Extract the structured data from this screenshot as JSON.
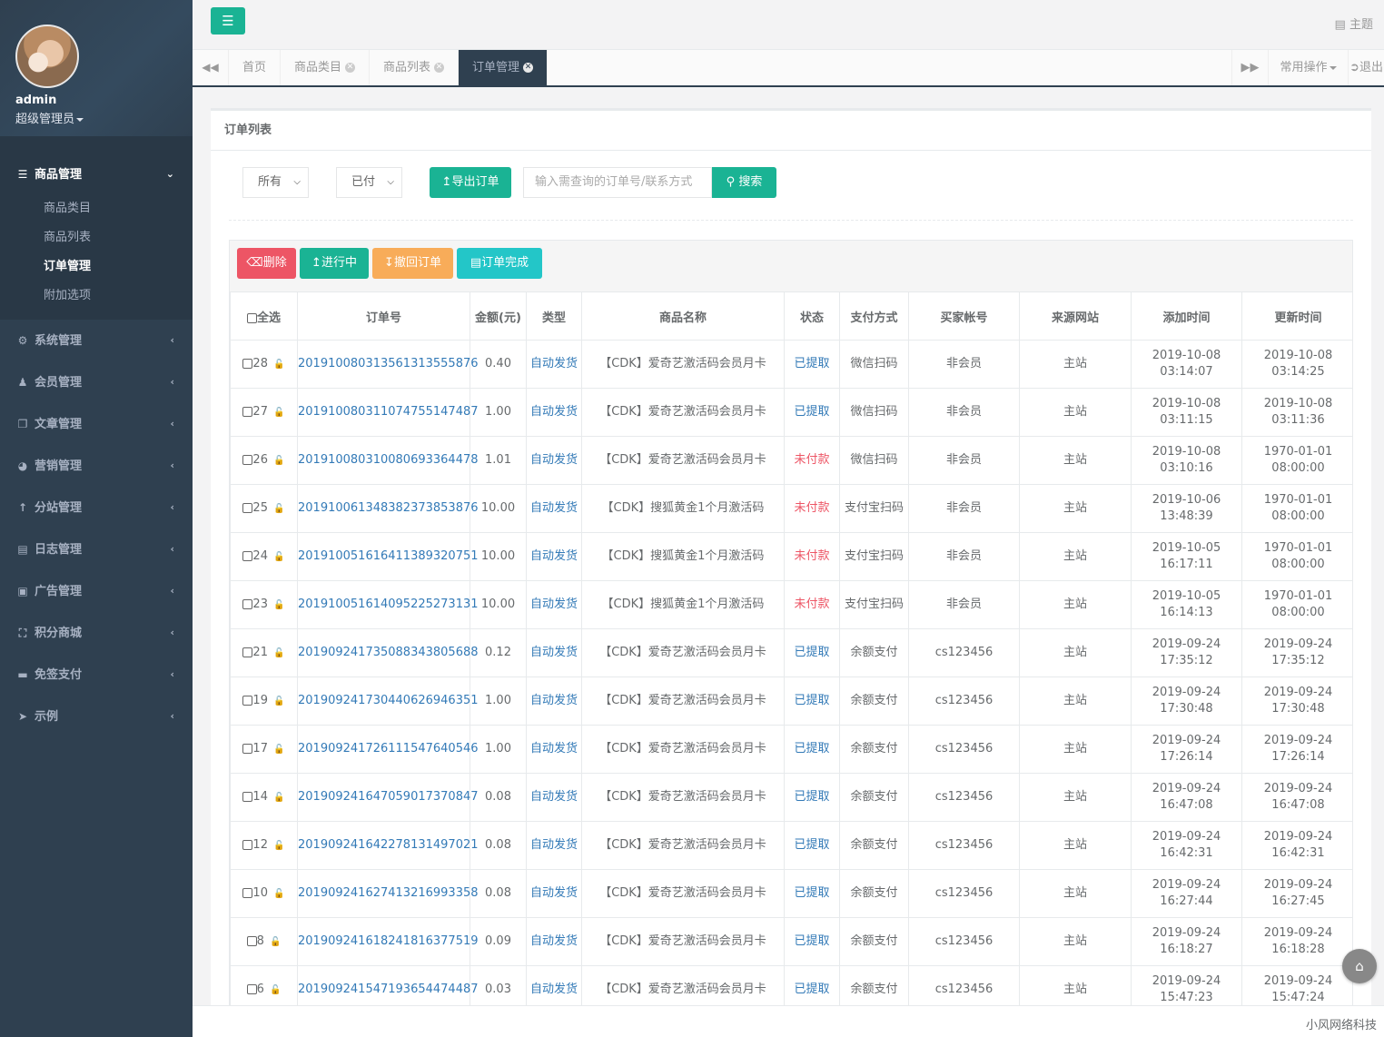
{
  "profile": {
    "name": "admin",
    "role": "超级管理员"
  },
  "nav": {
    "open_group": "商品管理",
    "sub_items": [
      "商品类目",
      "商品列表",
      "订单管理",
      "附加选项"
    ],
    "groups": [
      "系统管理",
      "会员管理",
      "文章管理",
      "营销管理",
      "分站管理",
      "日志管理",
      "广告管理",
      "积分商城",
      "免签支付",
      "示例"
    ]
  },
  "topbar": {
    "theme_label": "主题"
  },
  "tabs": {
    "items": [
      "首页",
      "商品类目",
      "商品列表",
      "订单管理"
    ],
    "common_ops": "常用操作",
    "logout": "退出"
  },
  "panel": {
    "title": "订单列表",
    "filter_all": "所有",
    "filter_status": "已付",
    "export_label": "导出订单",
    "search_placeholder": "输入需查询的订单号/联系方式",
    "search_label": "搜索"
  },
  "toolbar": {
    "delete": "删除",
    "in_progress": "进行中",
    "revoke": "撤回订单",
    "complete": "订单完成"
  },
  "table": {
    "headers": [
      "全选",
      "订单号",
      "金额(元)",
      "类型",
      "商品名称",
      "状态",
      "支付方式",
      "买家帐号",
      "来源网站",
      "添加时间",
      "更新时间"
    ],
    "rows": [
      {
        "id": "28",
        "order": "201910080313561313555876",
        "amount": "0.40",
        "type": "自动发货",
        "product": "【CDK】爱奇艺激活码会员月卡",
        "status": "已提取",
        "pay": "微信扫码",
        "buyer": "非会员",
        "site": "主站",
        "added": "2019-10-08 03:14:07",
        "updated": "2019-10-08 03:14:25"
      },
      {
        "id": "27",
        "order": "201910080311074755147487",
        "amount": "1.00",
        "type": "自动发货",
        "product": "【CDK】爱奇艺激活码会员月卡",
        "status": "已提取",
        "pay": "微信扫码",
        "buyer": "非会员",
        "site": "主站",
        "added": "2019-10-08 03:11:15",
        "updated": "2019-10-08 03:11:36"
      },
      {
        "id": "26",
        "order": "201910080310080693364478",
        "amount": "1.01",
        "type": "自动发货",
        "product": "【CDK】爱奇艺激活码会员月卡",
        "status": "未付款",
        "pay": "微信扫码",
        "buyer": "非会员",
        "site": "主站",
        "added": "2019-10-08 03:10:16",
        "updated": "1970-01-01 08:00:00"
      },
      {
        "id": "25",
        "order": "201910061348382373853876",
        "amount": "10.00",
        "type": "自动发货",
        "product": "【CDK】搜狐黄金1个月激活码",
        "status": "未付款",
        "pay": "支付宝扫码",
        "buyer": "非会员",
        "site": "主站",
        "added": "2019-10-06 13:48:39",
        "updated": "1970-01-01 08:00:00"
      },
      {
        "id": "24",
        "order": "201910051616411389320751",
        "amount": "10.00",
        "type": "自动发货",
        "product": "【CDK】搜狐黄金1个月激活码",
        "status": "未付款",
        "pay": "支付宝扫码",
        "buyer": "非会员",
        "site": "主站",
        "added": "2019-10-05 16:17:11",
        "updated": "1970-01-01 08:00:00"
      },
      {
        "id": "23",
        "order": "201910051614095225273131",
        "amount": "10.00",
        "type": "自动发货",
        "product": "【CDK】搜狐黄金1个月激活码",
        "status": "未付款",
        "pay": "支付宝扫码",
        "buyer": "非会员",
        "site": "主站",
        "added": "2019-10-05 16:14:13",
        "updated": "1970-01-01 08:00:00"
      },
      {
        "id": "21",
        "order": "201909241735088343805688",
        "amount": "0.12",
        "type": "自动发货",
        "product": "【CDK】爱奇艺激活码会员月卡",
        "status": "已提取",
        "pay": "余额支付",
        "buyer": "cs123456",
        "site": "主站",
        "added": "2019-09-24 17:35:12",
        "updated": "2019-09-24 17:35:12"
      },
      {
        "id": "19",
        "order": "201909241730440626946351",
        "amount": "1.00",
        "type": "自动发货",
        "product": "【CDK】爱奇艺激活码会员月卡",
        "status": "已提取",
        "pay": "余额支付",
        "buyer": "cs123456",
        "site": "主站",
        "added": "2019-09-24 17:30:48",
        "updated": "2019-09-24 17:30:48"
      },
      {
        "id": "17",
        "order": "201909241726111547640546",
        "amount": "1.00",
        "type": "自动发货",
        "product": "【CDK】爱奇艺激活码会员月卡",
        "status": "已提取",
        "pay": "余额支付",
        "buyer": "cs123456",
        "site": "主站",
        "added": "2019-09-24 17:26:14",
        "updated": "2019-09-24 17:26:14"
      },
      {
        "id": "14",
        "order": "201909241647059017370847",
        "amount": "0.08",
        "type": "自动发货",
        "product": "【CDK】爱奇艺激活码会员月卡",
        "status": "已提取",
        "pay": "余额支付",
        "buyer": "cs123456",
        "site": "主站",
        "added": "2019-09-24 16:47:08",
        "updated": "2019-09-24 16:47:08"
      },
      {
        "id": "12",
        "order": "201909241642278131497021",
        "amount": "0.08",
        "type": "自动发货",
        "product": "【CDK】爱奇艺激活码会员月卡",
        "status": "已提取",
        "pay": "余额支付",
        "buyer": "cs123456",
        "site": "主站",
        "added": "2019-09-24 16:42:31",
        "updated": "2019-09-24 16:42:31"
      },
      {
        "id": "10",
        "order": "201909241627413216993358",
        "amount": "0.08",
        "type": "自动发货",
        "product": "【CDK】爱奇艺激活码会员月卡",
        "status": "已提取",
        "pay": "余额支付",
        "buyer": "cs123456",
        "site": "主站",
        "added": "2019-09-24 16:27:44",
        "updated": "2019-09-24 16:27:45"
      },
      {
        "id": "8",
        "order": "201909241618241816377519",
        "amount": "0.09",
        "type": "自动发货",
        "product": "【CDK】爱奇艺激活码会员月卡",
        "status": "已提取",
        "pay": "余额支付",
        "buyer": "cs123456",
        "site": "主站",
        "added": "2019-09-24 16:18:27",
        "updated": "2019-09-24 16:18:28"
      },
      {
        "id": "6",
        "order": "201909241547193654474487",
        "amount": "0.03",
        "type": "自动发货",
        "product": "【CDK】爱奇艺激活码会员月卡",
        "status": "已提取",
        "pay": "余额支付",
        "buyer": "cs123456",
        "site": "主站",
        "added": "2019-09-24 15:47:23",
        "updated": "2019-09-24 15:47:24"
      }
    ]
  },
  "footer": {
    "brand": "小风网络科技"
  },
  "colors": {
    "primary": "#1ab394",
    "danger": "#ed5565",
    "warning": "#f8ac59",
    "info": "#23c6c8",
    "sidebar": "#2f4050",
    "link": "#337ab7"
  }
}
